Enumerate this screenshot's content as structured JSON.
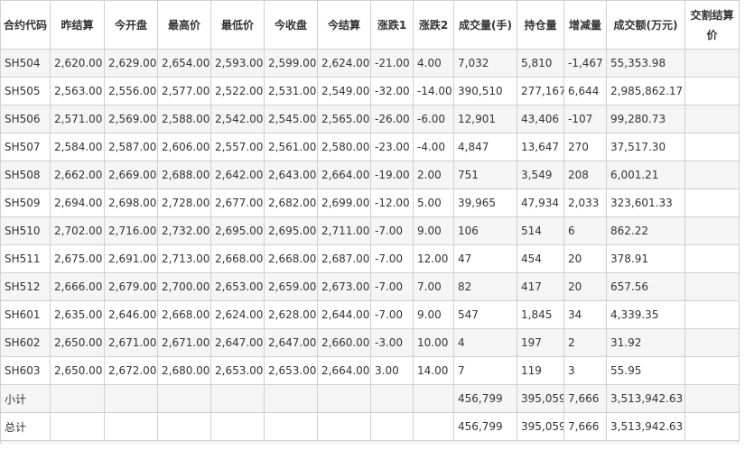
{
  "columns": [
    "合约代码",
    "昨结算",
    "今开盘",
    "最高价",
    "最低价",
    "今收盘",
    "今结算",
    "涨跌1",
    "涨跌2",
    "成交量(手)",
    "持仓量",
    "增减量",
    "成交额(万元)",
    "交割结算价"
  ],
  "rows": [
    [
      "SH504",
      "2,620.00",
      "2,629.00",
      "2,654.00",
      "2,593.00",
      "2,599.00",
      "2,624.00",
      "-21.00",
      "4.00",
      "7,032",
      "5,810",
      "-1,467",
      "55,353.98",
      ""
    ],
    [
      "SH505",
      "2,563.00",
      "2,556.00",
      "2,577.00",
      "2,522.00",
      "2,531.00",
      "2,549.00",
      "-32.00",
      "-14.00",
      "390,510",
      "277,167",
      "6,644",
      "2,985,862.17",
      ""
    ],
    [
      "SH506",
      "2,571.00",
      "2,569.00",
      "2,588.00",
      "2,542.00",
      "2,545.00",
      "2,565.00",
      "-26.00",
      "-6.00",
      "12,901",
      "43,406",
      "-107",
      "99,280.73",
      ""
    ],
    [
      "SH507",
      "2,584.00",
      "2,587.00",
      "2,606.00",
      "2,557.00",
      "2,561.00",
      "2,580.00",
      "-23.00",
      "-4.00",
      "4,847",
      "13,647",
      "270",
      "37,517.30",
      ""
    ],
    [
      "SH508",
      "2,662.00",
      "2,669.00",
      "2,688.00",
      "2,642.00",
      "2,643.00",
      "2,664.00",
      "-19.00",
      "2.00",
      "751",
      "3,549",
      "208",
      "6,001.21",
      ""
    ],
    [
      "SH509",
      "2,694.00",
      "2,698.00",
      "2,728.00",
      "2,677.00",
      "2,682.00",
      "2,699.00",
      "-12.00",
      "5.00",
      "39,965",
      "47,934",
      "2,033",
      "323,601.33",
      ""
    ],
    [
      "SH510",
      "2,702.00",
      "2,716.00",
      "2,732.00",
      "2,695.00",
      "2,695.00",
      "2,711.00",
      "-7.00",
      "9.00",
      "106",
      "514",
      "6",
      "862.22",
      ""
    ],
    [
      "SH511",
      "2,675.00",
      "2,691.00",
      "2,713.00",
      "2,668.00",
      "2,668.00",
      "2,687.00",
      "-7.00",
      "12.00",
      "47",
      "454",
      "20",
      "378.91",
      ""
    ],
    [
      "SH512",
      "2,666.00",
      "2,679.00",
      "2,700.00",
      "2,653.00",
      "2,659.00",
      "2,673.00",
      "-7.00",
      "7.00",
      "82",
      "417",
      "20",
      "657.56",
      ""
    ],
    [
      "SH601",
      "2,635.00",
      "2,646.00",
      "2,668.00",
      "2,624.00",
      "2,628.00",
      "2,644.00",
      "-7.00",
      "9.00",
      "547",
      "1,845",
      "34",
      "4,339.35",
      ""
    ],
    [
      "SH602",
      "2,650.00",
      "2,671.00",
      "2,671.00",
      "2,647.00",
      "2,647.00",
      "2,660.00",
      "-3.00",
      "10.00",
      "4",
      "197",
      "2",
      "31.92",
      ""
    ],
    [
      "SH603",
      "2,650.00",
      "2,672.00",
      "2,680.00",
      "2,653.00",
      "2,653.00",
      "2,664.00",
      "3.00",
      "14.00",
      "7",
      "119",
      "3",
      "55.95",
      ""
    ],
    [
      "小计",
      "",
      "",
      "",
      "",
      "",
      "",
      "",
      "",
      "456,799",
      "395,059",
      "7,666",
      "3,513,942.63",
      ""
    ],
    [
      "总计",
      "",
      "",
      "",
      "",
      "",
      "",
      "",
      "",
      "456,799",
      "395,059",
      "7,666",
      "3,513,942.63",
      ""
    ]
  ],
  "colors": {
    "border": "#d0d0d0",
    "stripe": "#f5f5f5",
    "text": "#333333"
  }
}
